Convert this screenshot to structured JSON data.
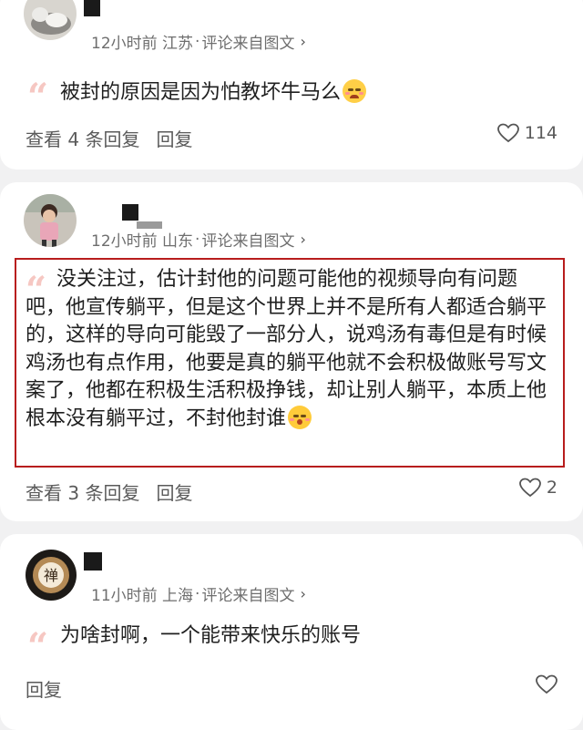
{
  "comments": [
    {
      "time": "12小时前",
      "location": "江苏",
      "source": "评论来自图文",
      "text": "被封的原因是因为怕教坏牛马么",
      "emoji_icon": "crying-face-icon",
      "view_replies": "查看 4 条回复",
      "reply_label": "回复",
      "likes": "114"
    },
    {
      "time": "12小时前",
      "location": "山东",
      "source": "评论来自图文",
      "text": "没关注过，估计封他的问题可能他的视频导向有问题吧，他宣传躺平，但是这个世界上并不是所有人都适合躺平的，这样的导向可能毁了一部分人，说鸡汤有毒但是有时候鸡汤也有点作用，他要是真的躺平他就不会积极做账号写文案了，他都在积极生活积极挣钱，却让别人躺平，本质上他根本没有躺平过，不封他封谁",
      "emoji_icon": "kissing-face-icon",
      "view_replies": "查看 3 条回复",
      "reply_label": "回复",
      "likes": "2"
    },
    {
      "time": "11小时前",
      "location": "上海",
      "source": "评论来自图文",
      "text": "为啥封啊，一个能带来快乐的账号",
      "reply_label": "回复",
      "likes": ""
    }
  ],
  "separator": "·",
  "chevron": "›",
  "quote_mark": "“",
  "colors": {
    "highlight_border": "#b81d1d",
    "quote_mark": "#f6c7c2",
    "meta_text": "#6e6e6e"
  }
}
